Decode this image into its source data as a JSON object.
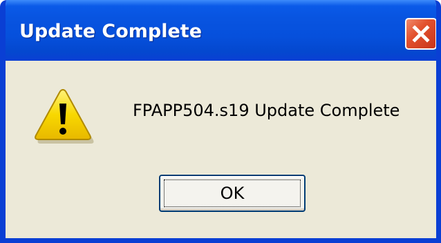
{
  "dialog": {
    "title": "Update Complete",
    "message": "FPAPP504.s19 Update Complete",
    "ok_label": "OK",
    "icon": "warning-icon",
    "close_icon": "close-icon"
  },
  "colors": {
    "titlebar": "#0854e0",
    "close_button": "#e2512e",
    "dialog_background": "#ece9d8",
    "warning_fill": "#f5d400"
  }
}
